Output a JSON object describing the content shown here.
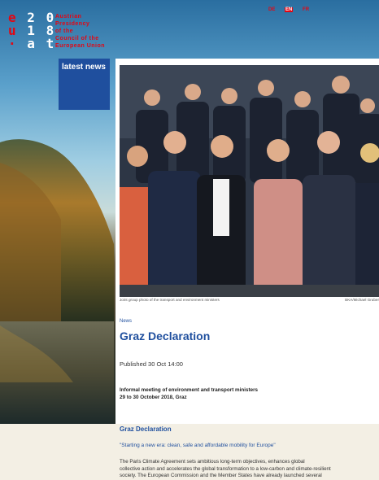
{
  "logo": {
    "row1": [
      "e",
      "2",
      "0"
    ],
    "row2": [
      "u",
      "1",
      "8"
    ],
    "row3": [
      "·",
      "a",
      "t"
    ]
  },
  "presidency": [
    "Austrian",
    "Presidency",
    "of the",
    "Council of the",
    "European Union"
  ],
  "languages": [
    {
      "label": "DE",
      "active": false
    },
    {
      "label": "EN",
      "active": true
    },
    {
      "label": "FR",
      "active": false
    }
  ],
  "latest_news_label": "latest news",
  "article": {
    "caption": "Joint group photo of the transport and environment ministers",
    "credit": "BKA/Michael Gruber",
    "kicker": "News",
    "title": "Graz Declaration",
    "published": "Published 30 Oct 14:00",
    "meeting_line1": "Informal meeting of environment and transport ministers",
    "meeting_line2": "29 to 30 October 2018, Graz",
    "subhead": "Graz Declaration",
    "quote": "\"Starting a new era: clean, safe and affordable mobility for Europe\"",
    "body_line1": "The Paris Climate Agreement sets ambitious long-term objectives, enhances global",
    "body_line2": "collective action and accelerates the global transformation to a low-carbon and climate-resilient",
    "body_line3": "society. The European Commission and the Member States have already launched several"
  },
  "colors": {
    "brand_red": "#e30613",
    "brand_blue": "#1f4f9e"
  }
}
